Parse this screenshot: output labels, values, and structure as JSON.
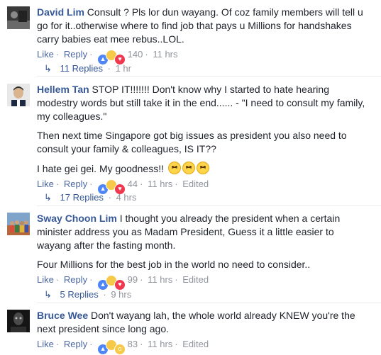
{
  "colors": {
    "link": "#365899",
    "meta": "#90949c",
    "text": "#1d2129"
  },
  "comments": [
    {
      "author": "David Lim",
      "avatar_icon": "avatar-dark-photo",
      "paragraphs": [
        "Consult ? Pls lor dun wayang. Of coz family members will tell u go for it..otherwise where to find job that pays u Millions for handshakes carry babies eat mee rebus..LOL."
      ],
      "like": "Like",
      "reply": "Reply",
      "reactions": [
        "like",
        "haha",
        "love"
      ],
      "reaction_count": "140",
      "time": "11 hrs",
      "edited": "",
      "replies_label": "11 Replies",
      "replies_time": "1 hr"
    },
    {
      "author": "Hellem Tan",
      "avatar_icon": "avatar-man-portrait",
      "paragraphs": [
        "STOP IT!!!!!!! Don't know why I started to hate hearing modestry words but still take it in the end...... - \"I need to consult my family, my colleagues.\"",
        "Then next time Singapore got big issues as president you also need to consult your family & colleagues, IS IT??",
        "I hate gei gei. My goodness!!"
      ],
      "like": "Like",
      "reply": "Reply",
      "reactions": [
        "like",
        "haha",
        "love"
      ],
      "reaction_count": "44",
      "time": "11 hrs",
      "edited": "Edited",
      "replies_label": "17 Replies",
      "replies_time": "4 hrs"
    },
    {
      "author": "Sway Choon Lim",
      "avatar_icon": "avatar-group-photo",
      "paragraphs": [
        "I thought you already the president when a certain minister address you as Madam President, Guess it a little easier to wayang after the fasting month.",
        "Four Millions for the best job in the world no need to consider.."
      ],
      "like": "Like",
      "reply": "Reply",
      "reactions": [
        "like",
        "haha",
        "love"
      ],
      "reaction_count": "99",
      "time": "11 hrs",
      "edited": "Edited",
      "replies_label": "5 Replies",
      "replies_time": "9 hrs"
    },
    {
      "author": "Bruce Wee",
      "avatar_icon": "avatar-dark-face",
      "paragraphs": [
        "Don't wayang lah, the whole world already KNEW you're the next president since long ago."
      ],
      "like": "Like",
      "reply": "Reply",
      "reactions": [
        "like",
        "haha",
        "wow"
      ],
      "reaction_count": "83",
      "time": "11 hrs",
      "edited": "Edited",
      "replies_label": "",
      "replies_time": ""
    }
  ]
}
